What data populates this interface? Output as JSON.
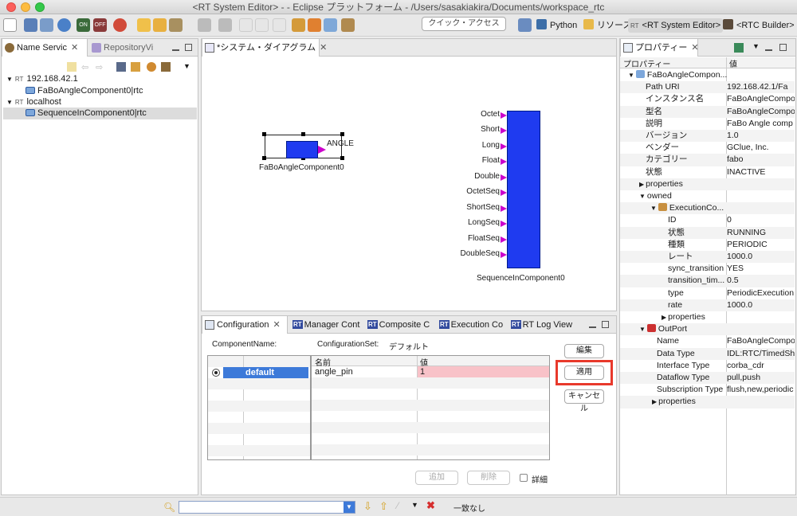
{
  "window": {
    "title": "<RT System Editor> -  - Eclipse プラットフォーム - /Users/sasakiakira/Documents/workspace_rtc"
  },
  "toolbar": {
    "quick_access": "クイック・アクセス",
    "perspectives": [
      {
        "label": "Python"
      },
      {
        "label": "リソース"
      },
      {
        "label": "<RT System Editor>"
      },
      {
        "label": "<RTC Builder>"
      }
    ]
  },
  "name_service": {
    "tabs": [
      {
        "label": "Name Servic"
      },
      {
        "label": "RepositoryVi"
      }
    ],
    "tree": [
      {
        "mark": "RT",
        "label": "192.168.42.1"
      },
      {
        "label": "FaBoAngleComponent0|rtc"
      },
      {
        "mark": "RT",
        "label": "localhost"
      },
      {
        "label": "SequenceInComponent0|rtc"
      }
    ]
  },
  "diagram": {
    "tab": "*システム・ダイアグラム",
    "comp1": {
      "name": "FaBoAngleComponent0",
      "port": "ANGLE"
    },
    "comp2": {
      "name": "SequenceInComponent0",
      "ports": [
        "Octet",
        "Short",
        "Long",
        "Float",
        "Double",
        "OctetSeq",
        "ShortSeq",
        "LongSeq",
        "FloatSeq",
        "DoubleSeq"
      ]
    }
  },
  "config": {
    "tabs": [
      {
        "label": "Configuration"
      },
      {
        "label": "Manager Cont"
      },
      {
        "label": "Composite C"
      },
      {
        "label": "Execution Co"
      },
      {
        "label": "RT Log View"
      }
    ],
    "component_label": "ComponentName:",
    "configset_label": "ConfigurationSet:",
    "configset_value": "デフォルト",
    "sets": [
      {
        "name": "default"
      }
    ],
    "headers": {
      "name": "名前",
      "value": "値"
    },
    "rows": [
      {
        "name": "angle_pin",
        "value": "1"
      }
    ],
    "buttons": {
      "edit": "編集",
      "apply": "適用",
      "cancel": "キャンセル",
      "add": "追加",
      "delete": "削除",
      "detail": "詳細"
    }
  },
  "properties": {
    "tab": "プロパティー",
    "headers": {
      "property": "プロパティー",
      "value": "値"
    },
    "rows": [
      {
        "arrow": "▼",
        "icon": "component",
        "label": "FaBoAngleCompon...",
        "value": ""
      },
      {
        "label": "Path URI",
        "value": "192.168.42.1/Fa"
      },
      {
        "label": "インスタンス名",
        "value": "FaBoAngleCompo"
      },
      {
        "label": "型名",
        "value": "FaBoAngleCompo"
      },
      {
        "label": "説明",
        "value": "FaBo Angle comp"
      },
      {
        "label": "バージョン",
        "value": "1.0"
      },
      {
        "label": "ベンダー",
        "value": "GClue, Inc."
      },
      {
        "label": "カテゴリー",
        "value": "fabo"
      },
      {
        "label": "状態",
        "value": "INACTIVE"
      },
      {
        "arrow": "▶",
        "label": "properties",
        "value": ""
      },
      {
        "arrow": "▼",
        "label": "owned",
        "value": ""
      },
      {
        "arrow": "▼",
        "icon": "exec",
        "label": "ExecutionCo...",
        "value": ""
      },
      {
        "label": "ID",
        "value": "0"
      },
      {
        "label": "状態",
        "value": "RUNNING"
      },
      {
        "label": "種類",
        "value": "PERIODIC"
      },
      {
        "label": "レート",
        "value": "1000.0"
      },
      {
        "label": "sync_transition",
        "value": "YES"
      },
      {
        "label": "transition_tim...",
        "value": "0.5"
      },
      {
        "label": "type",
        "value": "PeriodicExecution"
      },
      {
        "label": "rate",
        "value": "1000.0"
      },
      {
        "arrow": "▶",
        "label": "properties",
        "value": ""
      },
      {
        "arrow": "▼",
        "icon": "outport",
        "label": "OutPort",
        "value": ""
      },
      {
        "label": "Name",
        "value": "FaBoAngleCompo"
      },
      {
        "label": "Data Type",
        "value": "IDL:RTC/TimedSh"
      },
      {
        "label": "Interface Type",
        "value": "corba_cdr"
      },
      {
        "label": "Dataflow Type",
        "value": "pull,push"
      },
      {
        "label": "Subscription Type",
        "value": "flush,new,periodic"
      },
      {
        "arrow": "▶",
        "label": "properties",
        "value": ""
      }
    ]
  },
  "statusbar": {
    "find": "一致なし"
  },
  "colors": {
    "highlight": "#e8392b",
    "component_fill": "#1f3bf0",
    "port": "#cc00cc",
    "value_bg": "#f8c2c8",
    "selection": "#3d7ad9"
  }
}
